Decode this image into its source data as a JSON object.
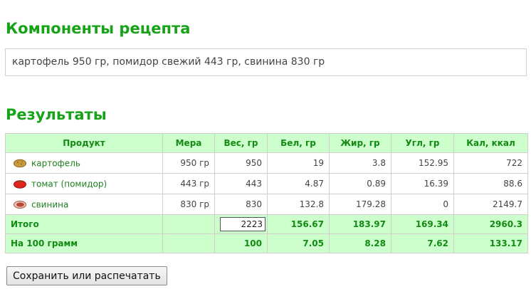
{
  "headings": {
    "components": "Компоненты рецепта",
    "results": "Результаты"
  },
  "recipe_text": "картофель 950 гр, помидор свежий 443 гр, свинина 830 гр",
  "table": {
    "columns": [
      "Продукт",
      "Мера",
      "Вес, гр",
      "Бел, гр",
      "Жир, гр",
      "Угл, гр",
      "Кал, ккал"
    ],
    "rows": [
      {
        "icon": "potato-icon",
        "name": "картофель",
        "measure": "950 гр",
        "weight": "950",
        "protein": "19",
        "fat": "3.8",
        "carbs": "152.95",
        "kcal": "722"
      },
      {
        "icon": "tomato-icon",
        "name": "томат (помидор)",
        "measure": "443 гр",
        "weight": "443",
        "protein": "4.87",
        "fat": "0.89",
        "carbs": "16.39",
        "kcal": "88.6"
      },
      {
        "icon": "pork-icon",
        "name": "свинина",
        "measure": "830 гр",
        "weight": "830",
        "protein": "132.8",
        "fat": "179.28",
        "carbs": "0",
        "kcal": "2149.7"
      }
    ],
    "total": {
      "label": "Итого",
      "weight": "2223",
      "protein": "156.67",
      "fat": "183.97",
      "carbs": "169.34",
      "kcal": "2960.3"
    },
    "per100": {
      "label": "На 100 грамм",
      "weight": "100",
      "protein": "7.05",
      "fat": "8.28",
      "carbs": "7.62",
      "kcal": "133.17"
    }
  },
  "save_button": "Сохранить или распечатать",
  "colors": {
    "accent": "#17a317",
    "table_header_bg": "#ccffcc",
    "link": "#1e7f1e"
  }
}
